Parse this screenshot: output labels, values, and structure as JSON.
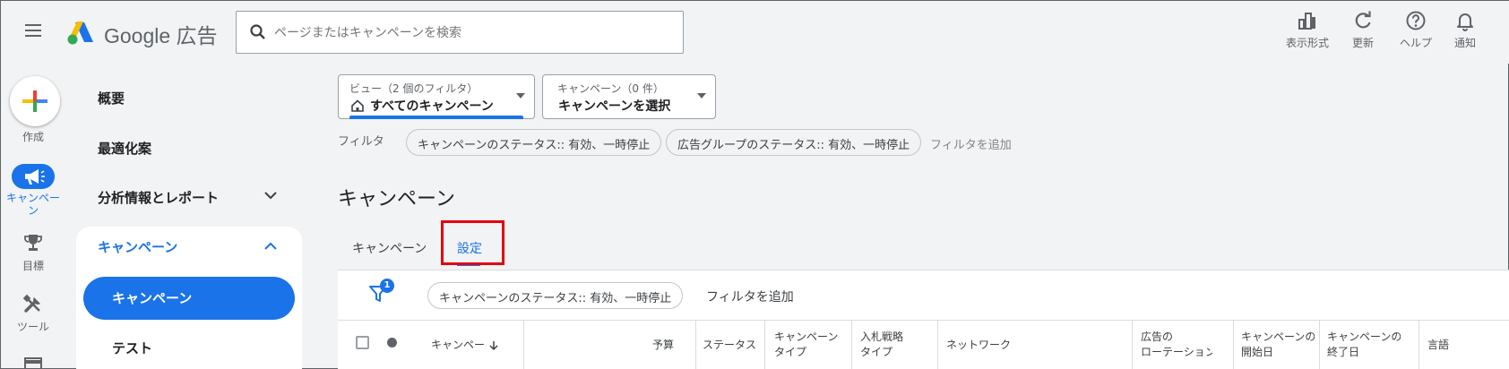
{
  "header": {
    "brand": "Google 広告",
    "search_placeholder": "ページまたはキャンペーンを検索",
    "tools": [
      {
        "label": "表示形式",
        "icon": "appearance-icon"
      },
      {
        "label": "更新",
        "icon": "refresh-icon"
      },
      {
        "label": "ヘルプ",
        "icon": "help-icon"
      },
      {
        "label": "通知",
        "icon": "bell-icon"
      }
    ]
  },
  "rail": {
    "create_label": "作成",
    "campaign_label": "キャンペー\nン",
    "goals_label": "目標",
    "tools_label": "ツール"
  },
  "nav": {
    "overview": "概要",
    "recommendations": "最適化案",
    "insights": "分析情報とレポート",
    "section_title": "キャンペーン",
    "active_item": "キャンペーン",
    "test_item": "テスト"
  },
  "main": {
    "view_dropdown": {
      "sub": "ビュー（2 個のフィルタ）",
      "main": "すべてのキャンペーン"
    },
    "campaign_dropdown": {
      "sub": "キャンペーン（0 件）",
      "main": "キャンペーンを選択"
    },
    "filter_label": "フィルタ",
    "filter_chips": [
      "キャンペーンのステータス:: 有効、一時停止",
      "広告グループのステータス:: 有効、一時停止"
    ],
    "add_filter": "フィルタを追加",
    "page_title": "キャンペーン",
    "tabs": [
      "キャンペーン",
      "設定"
    ],
    "table_filter_badge": "1",
    "table_filter_chip": "キャンペーンのステータス:: 有効、一時停止",
    "table_add_filter": "フィルタを追加",
    "columns": {
      "campaign": "キャンペー",
      "budget": "予算",
      "status": "ステータス",
      "type_1": "キャンペーン",
      "type_2": "タイプ",
      "bid_1": "入札戦略",
      "bid_2": "タイプ",
      "network": "ネットワーク",
      "rotation_1": "広告の",
      "rotation_2": "ローテーション",
      "start_1": "キャンペーンの",
      "start_2": "開始日",
      "end_1": "キャンペーンの",
      "end_2": "終了日",
      "language": "言語"
    }
  }
}
